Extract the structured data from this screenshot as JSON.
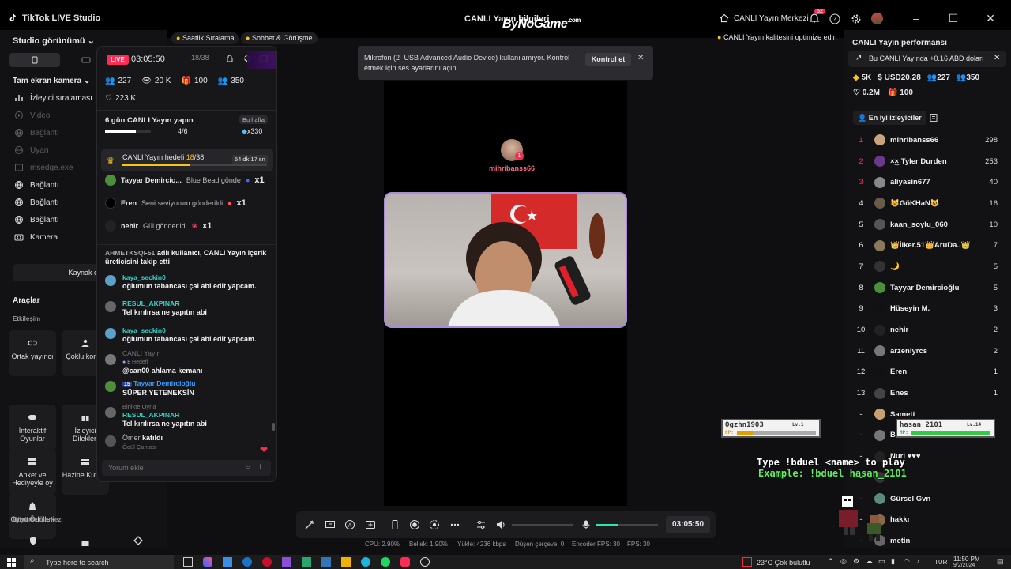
{
  "app": {
    "title": "TikTok LIVE Studio",
    "center_title": "CANLI Yayın bilgileri",
    "watermark": "ByNoGame",
    "watermark_domain": ".com",
    "help_center": "CANLI Yayın Merkezi",
    "notif_count": "62"
  },
  "top_pills": {
    "hourly_rank": "Saatlik Sıralama",
    "chat": "Sohbet & Görüşme",
    "optimize": "CANLI Yayın kalitesini optimize edin"
  },
  "left": {
    "header": "Studio görünümü",
    "source_label": "Tam ekran kamera",
    "sources": [
      "İzleyici sıralaması",
      "Video",
      "Bağlantı",
      "Uyarı",
      "msedge.exe",
      "Bağlantı",
      "Bağlantı",
      "Bağlantı",
      "Kamera"
    ],
    "add_source": "Kaynak ekle",
    "tools_title": "Araçlar",
    "interaction_label": "Etkileşim",
    "tools": [
      "Ortak yayıncı",
      "Çoklu konuk",
      "İnteraktif Oyunlar",
      "İzleyici Dilekleri",
      "Anket ve Hediyeyle oy",
      "Hazine Kutusu",
      "Oyun Ödülleri"
    ],
    "growth_label": "Büyüme merkezi"
  },
  "chat": {
    "live_badge": "LIVE",
    "timer": "03:05:50",
    "progress": "18/38",
    "stats": {
      "viewers": "227",
      "views": "20 K",
      "gifters": "100",
      "members": "350",
      "likes": "223 K"
    },
    "goal_title": "6 gün CANLI Yayın yapın",
    "goal_week": "Bu hafta",
    "goal_progress": "4/6",
    "goal_reward": "x330",
    "goal_fill": 0.67,
    "target_label": "CANLI Yayın hedefi",
    "target_value": "18",
    "target_total": "/38",
    "target_time": "54 dk 17 sn",
    "target_fill": 0.47,
    "gifts": [
      {
        "user": "Tayyar Demircio...",
        "text": "Blue Bead gönde",
        "count": "x1"
      },
      {
        "user": "Eren",
        "text": "Seni seviyorum gönderildi",
        "count": "x1"
      },
      {
        "user": "nehir",
        "text": "Gül gönderildi",
        "count": "x1"
      }
    ],
    "messages": [
      {
        "user": "AHMETKSQF51",
        "text": "adlı kullanıcı, CANLI Yayın içerik üreticisini takip etti"
      },
      {
        "user": "kaya_seckin0",
        "text": "oğlumun tabancası çal abi edit yapcam."
      },
      {
        "user": "RESUL_AKPINAR",
        "text": "Tel kırılırsa ne yapıtın abi"
      },
      {
        "user": "kaya_seckin0",
        "text": "oğlumun tabancası çal abi edit yapcam."
      },
      {
        "user": "CANLI Yayın",
        "text": "@can00 ahlama kemanı"
      },
      {
        "user": "Tayyar Demircioğlu",
        "text": "SÜPER YETENEKSİN"
      },
      {
        "user": "RESUL_AKPINAR",
        "text": "Tel kırılırsa ne yapıtın abi"
      },
      {
        "user": "Ömer",
        "text": "katıldı"
      }
    ],
    "badge_8": "8",
    "badge_15": "15",
    "ghost1": "Hedefi",
    "ghost2": "Birlikte Oyna",
    "ghost3": "Ödül Çantası",
    "input_placeholder": "Yorum ekle"
  },
  "notification": {
    "text": "Mikrofon (2- USB Advanced Audio Device) kullanılamıyor. Kontrol etmek için ses ayarlarını açın.",
    "button": "Kontrol et"
  },
  "stream": {
    "host": "mihribanss66",
    "host_count": "1"
  },
  "right": {
    "title": "CANLI Yayın performansı",
    "earn": "Bu CANLI Yayında +0.16 ABD doları",
    "stats": {
      "diamonds": "5K",
      "usd": "USD20.28",
      "viewers": "227",
      "members": "350",
      "likes": "0.2M",
      "gifters": "100"
    },
    "tab": "En iyi izleyiciler",
    "ranks": [
      {
        "n": "1",
        "name": "mihribanss66",
        "score": "298"
      },
      {
        "n": "2",
        "name": "×͜× Tyler Durden",
        "score": "253"
      },
      {
        "n": "3",
        "name": "aliyasin677",
        "score": "40"
      },
      {
        "n": "4",
        "name": "😺GöKHaN😺",
        "score": "16"
      },
      {
        "n": "5",
        "name": "kaan_soylu_060",
        "score": "10"
      },
      {
        "n": "6",
        "name": "👑İlker.51👑AruDa..👑",
        "score": "7"
      },
      {
        "n": "7",
        "name": "🌙",
        "score": "5"
      },
      {
        "n": "8",
        "name": "Tayyar Demircioğlu",
        "score": "5"
      },
      {
        "n": "9",
        "name": "Hüseyin M.",
        "score": "3"
      },
      {
        "n": "10",
        "name": "nehir",
        "score": "2"
      },
      {
        "n": "11",
        "name": "arzenlyrcs",
        "score": "2"
      },
      {
        "n": "12",
        "name": "Eren",
        "score": "1"
      },
      {
        "n": "13",
        "name": "Enes",
        "score": "1"
      },
      {
        "n": "-",
        "name": "Samett",
        "score": ""
      },
      {
        "n": "-",
        "name": "Bu",
        "score": ""
      },
      {
        "n": "-",
        "name": "Nuri ♥♥♥",
        "score": ""
      },
      {
        "n": "-",
        "name": "",
        "score": ""
      },
      {
        "n": "-",
        "name": "Gürsel Gvn",
        "score": ""
      },
      {
        "n": "-",
        "name": "hakkı",
        "score": ""
      },
      {
        "n": "-",
        "name": "metin",
        "score": ""
      }
    ]
  },
  "game": {
    "p1_name": "Ogzhn1903",
    "p1_lv": "Lv.1",
    "p1_hp_label": "HP:",
    "p2_name": "hasan_2101",
    "p2_lv": "Lv.14",
    "p2_hp_label": "HP:",
    "p1_hp": 0.2,
    "p2_hp": 1.0,
    "line1": "Type !bduel <name> to play",
    "line2": "Example: !bduel hasan_2101"
  },
  "controls": {
    "timer": "03:05:50",
    "mic_level": 0.35
  },
  "status": {
    "cpu": "CPU: 2.90%",
    "mem": "Bellek: 1.90%",
    "upload": "Yükle: 4236 kbps",
    "dropped": "Düşen çerçeve: 0",
    "enc": "Encoder FPS: 30",
    "fps": "FPS: 30"
  },
  "taskbar": {
    "search": "Type here to search",
    "weather": "23°C  Çok bulutlu",
    "lang": "TUR",
    "time": "11:50 PM",
    "date": "9/2/2024"
  }
}
